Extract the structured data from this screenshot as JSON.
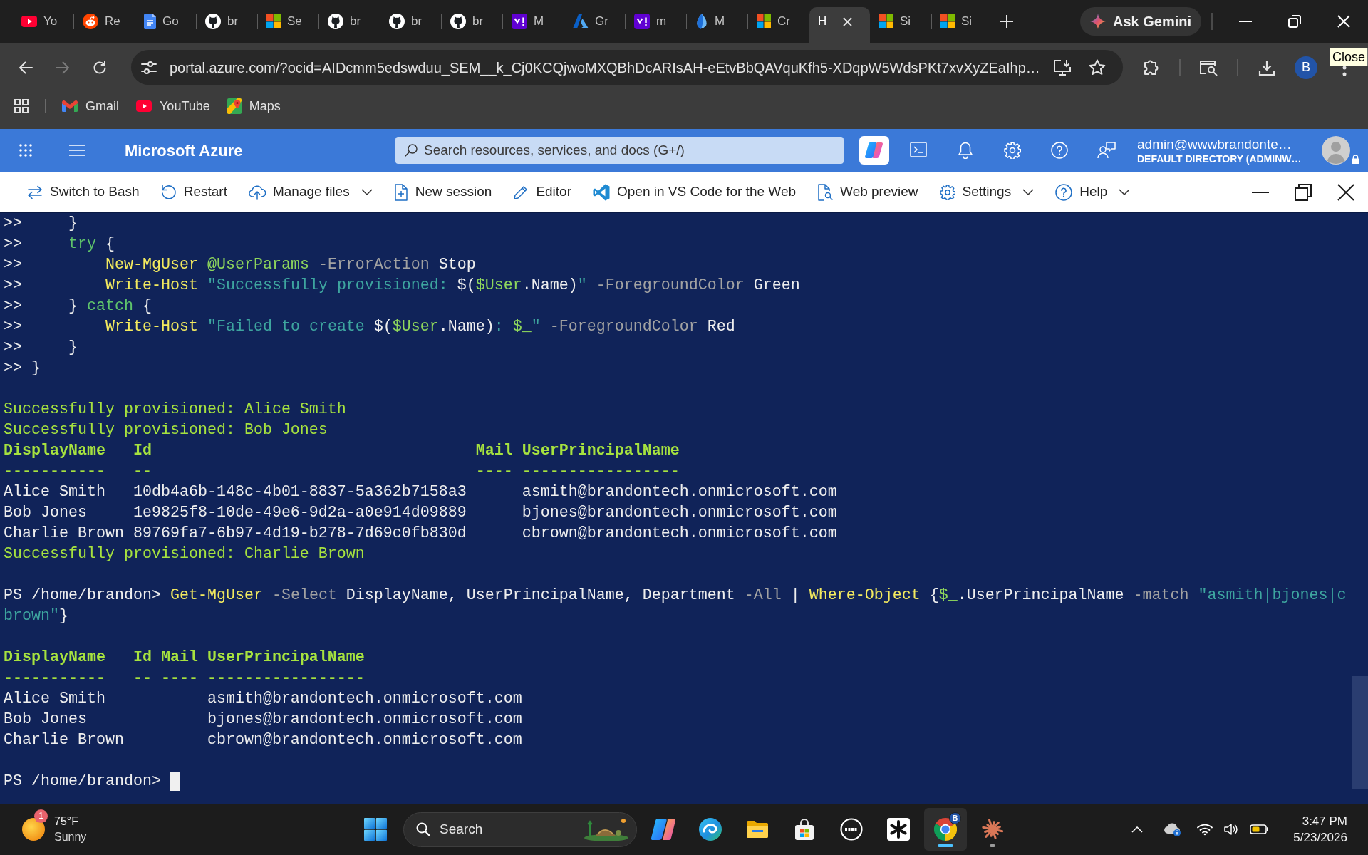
{
  "browser": {
    "tabs": [
      {
        "label": "Yo",
        "kind": "youtube",
        "selected": false
      },
      {
        "label": "Re",
        "kind": "reddit",
        "selected": false
      },
      {
        "label": "Go",
        "kind": "docs",
        "selected": false
      },
      {
        "label": "br",
        "kind": "github",
        "selected": false
      },
      {
        "label": "Se",
        "kind": "microsoft",
        "selected": false
      },
      {
        "label": "br",
        "kind": "github",
        "selected": false
      },
      {
        "label": "br",
        "kind": "github",
        "selected": false
      },
      {
        "label": "br",
        "kind": "github",
        "selected": false
      },
      {
        "label": "M",
        "kind": "yahoo",
        "selected": false
      },
      {
        "label": "Gr",
        "kind": "azure",
        "selected": false
      },
      {
        "label": "m",
        "kind": "yahoo",
        "selected": false
      },
      {
        "label": "M",
        "kind": "entra",
        "selected": false
      },
      {
        "label": "Cr",
        "kind": "microsoft",
        "selected": false
      },
      {
        "label": "H",
        "kind": "none",
        "selected": true
      },
      {
        "label": "Si",
        "kind": "microsoft",
        "selected": false
      },
      {
        "label": "Si",
        "kind": "microsoft",
        "selected": false
      }
    ],
    "ask_gemini": "Ask Gemini",
    "back_button": {
      "disabled": false
    },
    "forward_button": {
      "disabled": true
    },
    "url": "portal.azure.com/?ocid=AIDcmm5edswduu_SEM__k_Cj0KCQjwoMXQBhDcARIsAH-eEtvBbQAVquKfh5-XDqpW5WdsPKt7xvXyZEaIhp…",
    "profile_initial": "B",
    "tooltip": "Close",
    "bookmarks": [
      {
        "label": "Gmail",
        "kind": "gmail"
      },
      {
        "label": "YouTube",
        "kind": "youtube"
      },
      {
        "label": "Maps",
        "kind": "maps"
      }
    ]
  },
  "portal": {
    "title": "Microsoft Azure",
    "search": {
      "placeholder": "Search resources, services, and docs (G+/)"
    },
    "account": {
      "email": "admin@wwwbrandonte…",
      "directory": "DEFAULT DIRECTORY (ADMINW…"
    }
  },
  "cloud_shell": {
    "toolbar": [
      {
        "label": "Switch to Bash",
        "kind": "switch",
        "dropdown": false
      },
      {
        "label": "Restart",
        "kind": "restart",
        "dropdown": false
      },
      {
        "label": "Manage files",
        "kind": "files",
        "dropdown": true
      },
      {
        "label": "New session",
        "kind": "session",
        "dropdown": false
      },
      {
        "label": "Editor",
        "kind": "editor",
        "dropdown": false
      },
      {
        "label": "Open in VS Code for the Web",
        "kind": "vscode",
        "dropdown": false
      },
      {
        "label": "Web preview",
        "kind": "preview",
        "dropdown": false
      },
      {
        "label": "Settings",
        "kind": "settings",
        "dropdown": true
      },
      {
        "label": "Help",
        "kind": "help",
        "dropdown": true
      }
    ],
    "terminal": {
      "blocks": [
        [
          {
            "segments": [
              {
                "text": ">>     }",
                "kind": "text"
              }
            ]
          },
          {
            "segments": [
              {
                "text": ">>     ",
                "kind": "text"
              },
              {
                "text": "try",
                "kind": "keyword"
              },
              {
                "text": " {",
                "kind": "text"
              }
            ]
          },
          {
            "segments": [
              {
                "text": ">>         ",
                "kind": "text"
              },
              {
                "text": "New-MgUser",
                "kind": "command"
              },
              {
                "text": " @UserParams",
                "kind": "variable"
              },
              {
                "text": " -ErrorAction",
                "kind": "parameter"
              },
              {
                "text": " Stop",
                "kind": "text"
              }
            ]
          },
          {
            "segments": [
              {
                "text": ">>         ",
                "kind": "text"
              },
              {
                "text": "Write-Host",
                "kind": "command"
              },
              {
                "text": " \"Successfully provisioned: ",
                "kind": "string"
              },
              {
                "text": "$(",
                "kind": "text"
              },
              {
                "text": "$User",
                "kind": "variable"
              },
              {
                "text": ".Name)",
                "kind": "text"
              },
              {
                "text": "\"",
                "kind": "string"
              },
              {
                "text": " -ForegroundColor",
                "kind": "parameter"
              },
              {
                "text": " Green",
                "kind": "text"
              }
            ]
          },
          {
            "segments": [
              {
                "text": ">>     } ",
                "kind": "text"
              },
              {
                "text": "catch",
                "kind": "keyword"
              },
              {
                "text": " {",
                "kind": "text"
              }
            ]
          },
          {
            "segments": [
              {
                "text": ">>         ",
                "kind": "text"
              },
              {
                "text": "Write-Host",
                "kind": "command"
              },
              {
                "text": " \"Failed to create ",
                "kind": "string"
              },
              {
                "text": "$(",
                "kind": "text"
              },
              {
                "text": "$User",
                "kind": "variable"
              },
              {
                "text": ".Name)",
                "kind": "text"
              },
              {
                "text": ": ",
                "kind": "string"
              },
              {
                "text": "$_",
                "kind": "variable"
              },
              {
                "text": "\"",
                "kind": "string"
              },
              {
                "text": " -ForegroundColor",
                "kind": "parameter"
              },
              {
                "text": " Red",
                "kind": "text"
              }
            ]
          },
          {
            "segments": [
              {
                "text": ">>     }",
                "kind": "text"
              }
            ]
          },
          {
            "segments": [
              {
                "text": ">> }",
                "kind": "text"
              }
            ]
          }
        ],
        [
          {
            "segments": [
              {
                "text": "Successfully provisioned: Alice Smith",
                "kind": "output"
              }
            ]
          },
          {
            "segments": [
              {
                "text": "Successfully provisioned: Bob Jones",
                "kind": "output"
              }
            ]
          },
          {
            "segments": [
              {
                "text": "DisplayName   Id                                   Mail UserPrincipalName",
                "kind": "header"
              }
            ]
          },
          {
            "segments": [
              {
                "text": "-----------   --                                   ---- -----------------",
                "kind": "header"
              }
            ]
          },
          {
            "segments": [
              {
                "text": "Alice Smith   10db4a6b-148c-4b01-8837-5a362b7158a3      asmith@brandontech.onmicrosoft.com",
                "kind": "text"
              }
            ]
          },
          {
            "segments": [
              {
                "text": "Bob Jones     1e9825f8-10de-49e6-9d2a-a0e914d09889      bjones@brandontech.onmicrosoft.com",
                "kind": "text"
              }
            ]
          },
          {
            "segments": [
              {
                "text": "Charlie Brown 89769fa7-6b97-4d19-b278-7d69c0fb830d      cbrown@brandontech.onmicrosoft.com",
                "kind": "text"
              }
            ]
          },
          {
            "segments": [
              {
                "text": "Successfully provisioned: Charlie Brown",
                "kind": "output"
              }
            ]
          }
        ],
        [
          {
            "segments": [
              {
                "text": "PS /home/brandon> ",
                "kind": "text"
              },
              {
                "text": "Get-MgUser",
                "kind": "command"
              },
              {
                "text": " -Select",
                "kind": "parameter"
              },
              {
                "text": " DisplayName, UserPrincipalName, Department",
                "kind": "text"
              },
              {
                "text": " -All",
                "kind": "parameter"
              },
              {
                "text": " | ",
                "kind": "text"
              },
              {
                "text": "Where-Object",
                "kind": "command"
              },
              {
                "text": " {",
                "kind": "text"
              },
              {
                "text": "$_",
                "kind": "variable"
              },
              {
                "text": ".UserPrincipalName",
                "kind": "text"
              },
              {
                "text": " -match",
                "kind": "parameter"
              },
              {
                "text": " \"asmith|bjones|c",
                "kind": "string"
              }
            ]
          },
          {
            "segments": [
              {
                "text": "brown\"",
                "kind": "string"
              },
              {
                "text": "}",
                "kind": "text"
              }
            ]
          }
        ],
        [
          {
            "segments": [
              {
                "text": "DisplayName   Id Mail UserPrincipalName",
                "kind": "header"
              }
            ]
          },
          {
            "segments": [
              {
                "text": "-----------   -- ---- -----------------",
                "kind": "header"
              }
            ]
          },
          {
            "segments": [
              {
                "text": "Alice Smith           asmith@brandontech.onmicrosoft.com",
                "kind": "text"
              }
            ]
          },
          {
            "segments": [
              {
                "text": "Bob Jones             bjones@brandontech.onmicrosoft.com",
                "kind": "text"
              }
            ]
          },
          {
            "segments": [
              {
                "text": "Charlie Brown         cbrown@brandontech.onmicrosoft.com",
                "kind": "text"
              }
            ]
          }
        ],
        [
          {
            "segments": [
              {
                "text": "PS /home/brandon> ",
                "kind": "text"
              }
            ]
          }
        ]
      ],
      "cursor": true
    }
  },
  "taskbar": {
    "weather": {
      "temperature": "75°F",
      "condition": "Sunny",
      "badge": "1"
    },
    "search": {
      "placeholder": "Search"
    },
    "apps": [
      {
        "kind": "copilot",
        "selected": false,
        "running": false
      },
      {
        "kind": "edge",
        "selected": false,
        "running": false
      },
      {
        "kind": "explorer",
        "selected": false,
        "running": false
      },
      {
        "kind": "store",
        "selected": false,
        "running": false
      },
      {
        "kind": "dell",
        "selected": false,
        "running": false
      },
      {
        "kind": "spark",
        "selected": false,
        "running": false
      },
      {
        "kind": "chrome",
        "selected": true,
        "running": true,
        "badge": "B"
      },
      {
        "kind": "claude",
        "selected": false,
        "running": true
      }
    ],
    "clock": {
      "time": "3:47 PM",
      "date": "5/23/2026"
    }
  }
}
